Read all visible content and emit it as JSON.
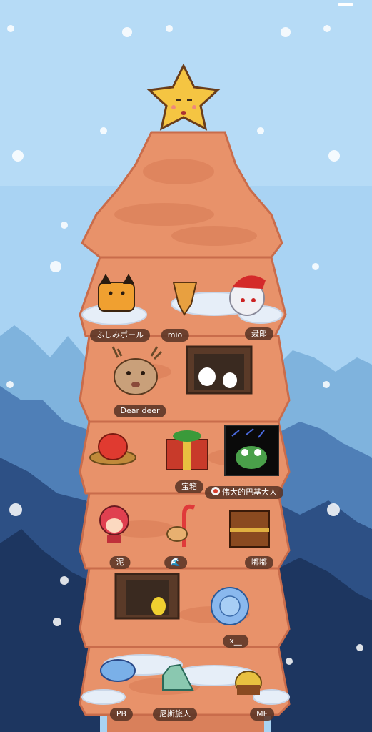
{
  "colors": {
    "sky": "#a9d3f3",
    "tree": "#e8926a",
    "tree_dark": "#c96c4b",
    "tag_bg": "#5a3426",
    "star": "#f5c542"
  },
  "ornaments": [
    {
      "label": "ふしみポール",
      "icon": "fox-plush-icon"
    },
    {
      "label": "mio",
      "icon": "leaf-creature-icon"
    },
    {
      "label": "聂郎",
      "icon": "santa-hat-character-icon"
    },
    {
      "label": "Dear deer",
      "icon": "reindeer-icon"
    },
    {
      "label": "",
      "icon": "window-ghosts-icon"
    },
    {
      "label": "",
      "icon": "red-egg-nest-icon"
    },
    {
      "label": "宝箱",
      "icon": "gift-chest-icon"
    },
    {
      "label": "伟大的巴基大人",
      "icon": "frog-portrait-icon"
    },
    {
      "label": "泥",
      "icon": "red-hair-girl-icon"
    },
    {
      "label": "🌊",
      "icon": "candy-cane-cat-icon"
    },
    {
      "label": "嘟嘟",
      "icon": "treasure-chest-icon"
    },
    {
      "label": "",
      "icon": "window-person-icon"
    },
    {
      "label": "x__",
      "icon": "blue-rose-icon"
    },
    {
      "label": "PB",
      "icon": "blue-whale-icon"
    },
    {
      "label": "尼斯旅人",
      "icon": "green-dinosaur-icon"
    },
    {
      "label": "MF",
      "icon": "bee-basket-icon"
    }
  ]
}
